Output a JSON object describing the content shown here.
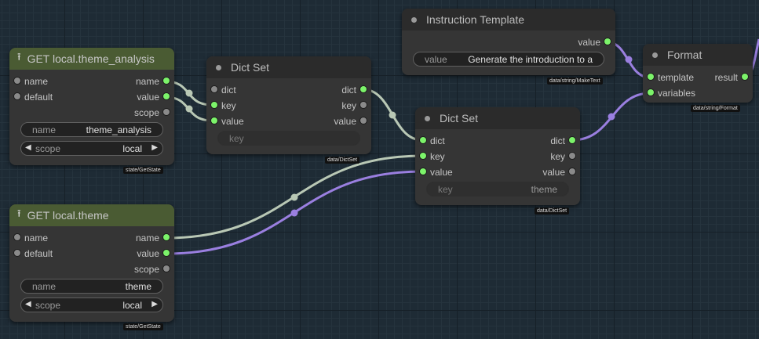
{
  "colors": {
    "background": "#1e2b35",
    "wire_grey": "#b9c8b5",
    "wire_purple": "#9a7fe0",
    "slot_connected": "#7cf36a",
    "slot_empty": "#8a8a8a",
    "get_node_header": "#4a5b33"
  },
  "nodes": {
    "get_theme_analysis": {
      "title": "GET local.theme_analysis",
      "icon": "upload-icon",
      "inputs": [
        "name",
        "default"
      ],
      "outputs": [
        "name",
        "value",
        "scope"
      ],
      "name_widget": {
        "label": "name",
        "value": "theme_analysis"
      },
      "scope_widget": {
        "label": "scope",
        "value": "local"
      },
      "type": "state/GetState"
    },
    "get_theme": {
      "title": "GET local.theme",
      "icon": "upload-icon",
      "inputs": [
        "name",
        "default"
      ],
      "outputs": [
        "name",
        "value",
        "scope"
      ],
      "name_widget": {
        "label": "name",
        "value": "theme"
      },
      "scope_widget": {
        "label": "scope",
        "value": "local"
      },
      "type": "state/GetState"
    },
    "dict_set_1": {
      "title": "Dict Set",
      "inputs": [
        "dict",
        "key",
        "value"
      ],
      "outputs": [
        "dict",
        "key",
        "value"
      ],
      "key_widget": {
        "label": "key",
        "value": ""
      },
      "type": "data/DictSet"
    },
    "dict_set_2": {
      "title": "Dict Set",
      "inputs": [
        "dict",
        "key",
        "value"
      ],
      "outputs": [
        "dict",
        "key",
        "value"
      ],
      "key_widget": {
        "label": "key",
        "value": "theme"
      },
      "type": "data/DictSet"
    },
    "instruction_template": {
      "title": "Instruction Template",
      "outputs": [
        "value"
      ],
      "value_widget": {
        "label": "value",
        "value": "Generate the introduction to a"
      },
      "type": "data/string/MakeText"
    },
    "format": {
      "title": "Format",
      "inputs": [
        "template",
        "variables"
      ],
      "outputs": [
        "result"
      ],
      "type": "data/string/Format"
    }
  }
}
